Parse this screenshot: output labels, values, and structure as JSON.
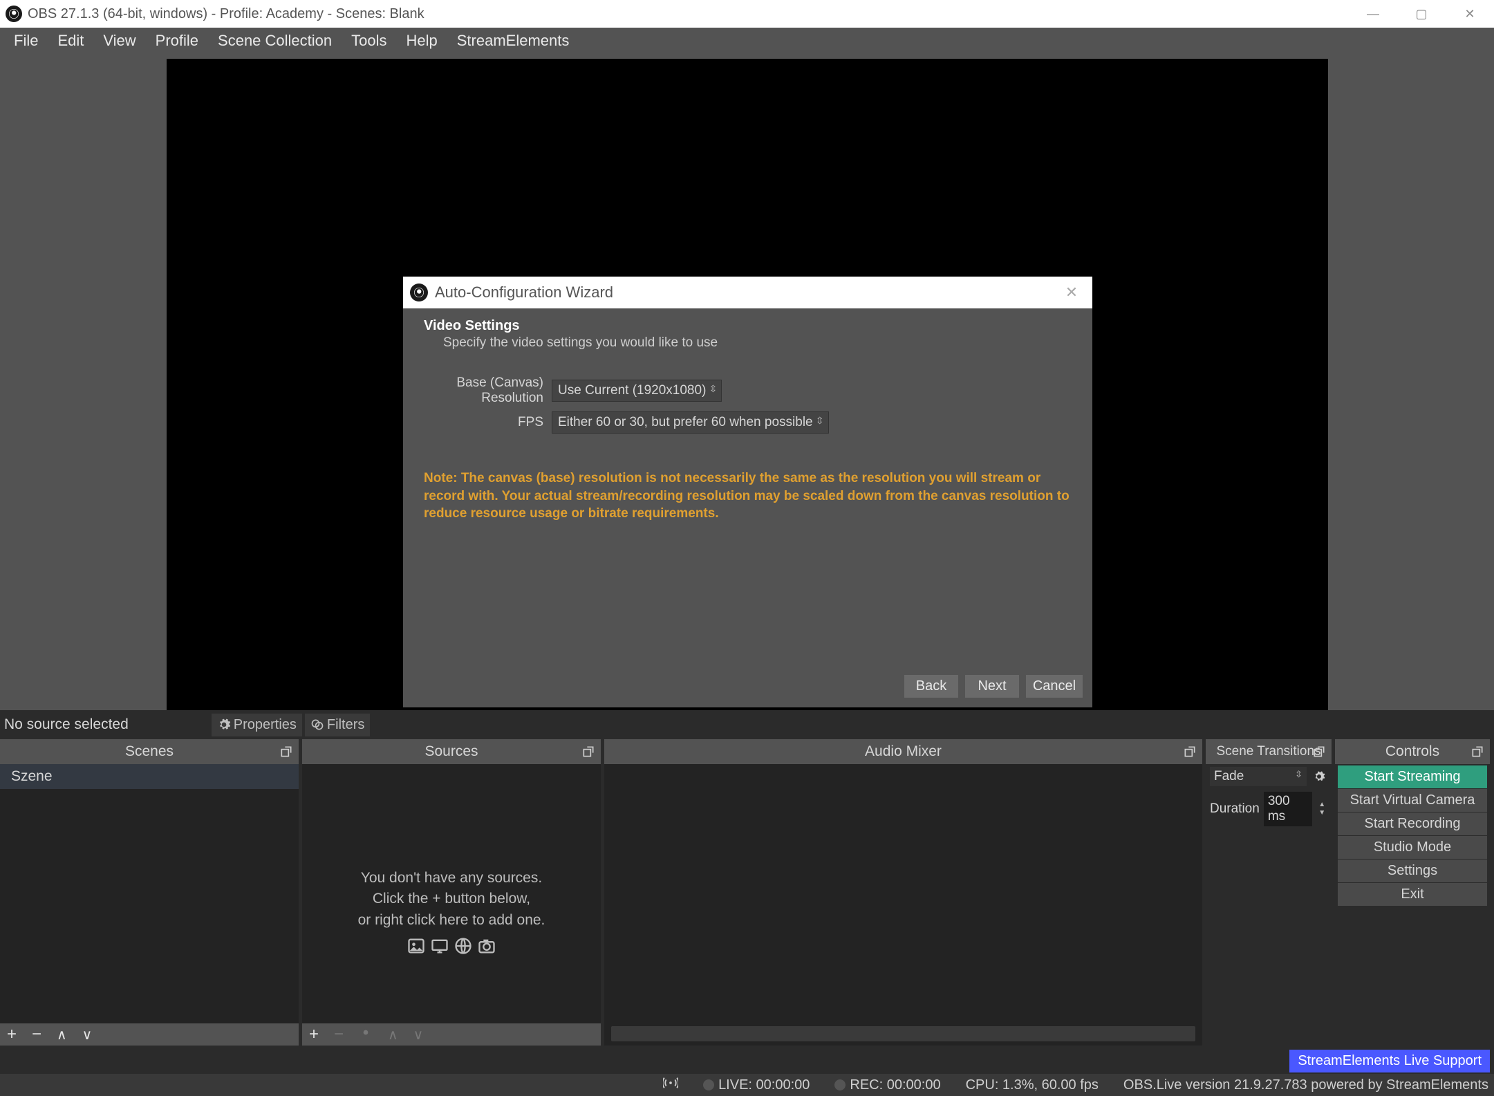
{
  "titlebar": {
    "title": "OBS 27.1.3 (64-bit, windows) - Profile: Academy - Scenes: Blank"
  },
  "menu": {
    "items": [
      "File",
      "Edit",
      "View",
      "Profile",
      "Scene Collection",
      "Tools",
      "Help",
      "StreamElements"
    ]
  },
  "wizard": {
    "title": "Auto-Configuration Wizard",
    "heading": "Video Settings",
    "subheading": "Specify the video settings you would like to use",
    "fields": {
      "resolution_label": "Base (Canvas) Resolution",
      "resolution_value": "Use Current (1920x1080)",
      "fps_label": "FPS",
      "fps_value": "Either 60 or 30, but prefer 60 when possible"
    },
    "note": "Note: The canvas (base) resolution is not necessarily the same as the resolution you will stream or record with. Your actual stream/recording resolution may be scaled down from the canvas resolution to reduce resource usage or bitrate requirements.",
    "buttons": {
      "back": "Back",
      "next": "Next",
      "cancel": "Cancel"
    }
  },
  "source_toolbar": {
    "no_source": "No source selected",
    "properties": "Properties",
    "filters": "Filters"
  },
  "panels": {
    "scenes": {
      "title": "Scenes",
      "items": [
        "Szene"
      ]
    },
    "sources": {
      "title": "Sources",
      "empty_l1": "You don't have any sources.",
      "empty_l2": "Click the + button below,",
      "empty_l3": "or right click here to add one."
    },
    "mixer": {
      "title": "Audio Mixer"
    },
    "transitions": {
      "title": "Scene Transitions",
      "type": "Fade",
      "duration_label": "Duration",
      "duration_value": "300 ms"
    },
    "controls": {
      "title": "Controls",
      "buttons": [
        "Start Streaming",
        "Start Virtual Camera",
        "Start Recording",
        "Studio Mode",
        "Settings",
        "Exit"
      ]
    }
  },
  "statusbar": {
    "live": "LIVE: 00:00:00",
    "rec": "REC: 00:00:00",
    "cpu": "CPU: 1.3%, 60.00 fps",
    "obslive": "OBS.Live version 21.9.27.783 powered by StreamElements",
    "support": "StreamElements Live Support"
  }
}
